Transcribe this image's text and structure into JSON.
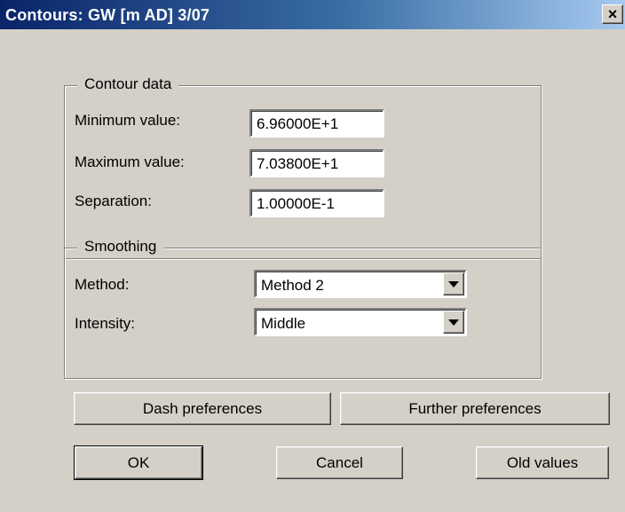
{
  "window": {
    "title": "Contours:  GW [m AD] 3/07",
    "close_glyph": "×"
  },
  "contour_data": {
    "group_title": "Contour data",
    "min_label": "Minimum value:",
    "min_value": "6.96000E+1",
    "max_label": "Maximum value:",
    "max_value": "7.03800E+1",
    "sep_label": "Separation:",
    "sep_value": "1.00000E-1"
  },
  "smoothing": {
    "group_title": "Smoothing",
    "method_label": "Method:",
    "method_value": "Method 2",
    "intensity_label": "Intensity:",
    "intensity_value": "Middle"
  },
  "buttons": {
    "dash_prefs": "Dash preferences",
    "further_prefs": "Further preferences",
    "ok": "OK",
    "cancel": "Cancel",
    "old_values": "Old values"
  },
  "icons": {
    "close": "close-icon",
    "dropdown": "chevron-down-icon"
  }
}
